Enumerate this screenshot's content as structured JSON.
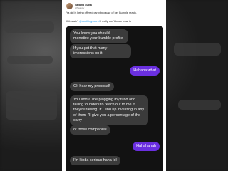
{
  "tweet": {
    "author_name": "Sayatha Gupta",
    "author_handle": "@Sasotry",
    "more_icon": "more-horizontal-icon",
    "text_1": "Ya girl is being offered carry because of her Bumble reach.",
    "text_2_prefix": "If this ain't ",
    "text_2_mention": "@soothingsound",
    "text_2_suffix": " I really don't know what is"
  },
  "chat": {
    "messages": [
      {
        "side": "in",
        "text": "You know you should monetize your bumble profile"
      },
      {
        "side": "in",
        "text": "If you get that many impressions on it"
      },
      {
        "side": "out",
        "text": "Hahaha what"
      },
      {
        "side": "in",
        "text": "Ok hear my proposal!"
      },
      {
        "side": "in",
        "text": "You add a line plugging my fund and telling founders to reach out to me if they're raising. If I end up investing in any of them I'll give you a percentage of the carry"
      },
      {
        "side": "in",
        "text": "of those companies"
      },
      {
        "side": "out",
        "text": "Hahahahah"
      },
      {
        "side": "in",
        "text": "I'm kinda serious haha lol"
      }
    ]
  },
  "colors": {
    "incoming_bubble": "#3b3b3b",
    "outgoing_bubble": "#6a2fe0",
    "chat_background": "#121212",
    "mention": "#1d9bf0"
  }
}
